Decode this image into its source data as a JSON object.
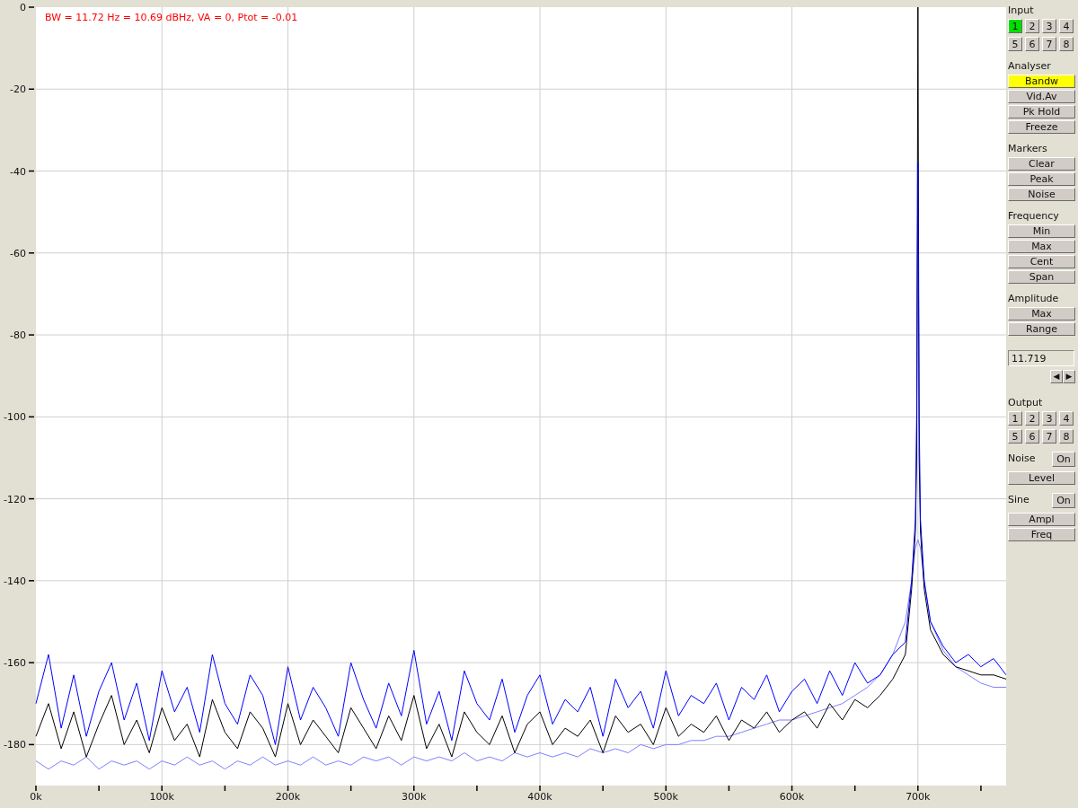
{
  "spectrum": {
    "info": "BW = 11.72 Hz = 10.69 dBHz, VA = 0, Ptot = -0.01",
    "chart_data": {
      "type": "line",
      "grid": true,
      "xlim": [
        0,
        770
      ],
      "ylim": [
        -190,
        0
      ],
      "yticks": [
        0,
        -20,
        -40,
        -60,
        -80,
        -100,
        -120,
        -140,
        -160,
        -180
      ],
      "xticks": [
        {
          "value": 0,
          "label": "0k"
        },
        {
          "value": 100,
          "label": "100k"
        },
        {
          "value": 200,
          "label": "200k"
        },
        {
          "value": 300,
          "label": "300k"
        },
        {
          "value": 400,
          "label": "400k"
        },
        {
          "value": 500,
          "label": "500k"
        },
        {
          "value": 600,
          "label": "600k"
        },
        {
          "value": 700,
          "label": "700k"
        }
      ],
      "x": [
        0,
        10,
        20,
        30,
        40,
        50,
        60,
        70,
        80,
        90,
        100,
        110,
        120,
        130,
        140,
        150,
        160,
        170,
        180,
        190,
        200,
        210,
        220,
        230,
        240,
        250,
        260,
        270,
        280,
        290,
        300,
        310,
        320,
        330,
        340,
        350,
        360,
        370,
        380,
        390,
        400,
        410,
        420,
        430,
        440,
        450,
        460,
        470,
        480,
        490,
        500,
        510,
        520,
        530,
        540,
        550,
        560,
        570,
        580,
        590,
        600,
        610,
        620,
        630,
        640,
        650,
        660,
        670,
        680,
        690,
        695,
        698,
        699,
        700,
        701,
        702,
        705,
        710,
        720,
        730,
        740,
        750,
        760,
        770
      ],
      "series": [
        {
          "color": "#8080ff",
          "values": [
            -184,
            -186,
            -184,
            -185,
            -183,
            -186,
            -184,
            -185,
            -184,
            -186,
            -184,
            -185,
            -183,
            -185,
            -184,
            -186,
            -184,
            -185,
            -183,
            -185,
            -184,
            -185,
            -183,
            -185,
            -184,
            -185,
            -183,
            -184,
            -183,
            -185,
            -183,
            -184,
            -183,
            -184,
            -182,
            -184,
            -183,
            -184,
            -182,
            -183,
            -182,
            -183,
            -182,
            -183,
            -181,
            -182,
            -181,
            -182,
            -180,
            -181,
            -180,
            -180,
            -179,
            -179,
            -178,
            -178,
            -177,
            -176,
            -175,
            -174,
            -174,
            -173,
            -172,
            -171,
            -170,
            -168,
            -166,
            -163,
            -158,
            -150,
            -140,
            -132,
            -131,
            -130,
            -131,
            -132,
            -140,
            -150,
            -157,
            -161,
            -163,
            -165,
            -166,
            -166
          ]
        },
        {
          "color": "#000000",
          "values": [
            -178,
            -170,
            -181,
            -172,
            -183,
            -175,
            -168,
            -180,
            -174,
            -182,
            -171,
            -179,
            -175,
            -183,
            -169,
            -177,
            -181,
            -172,
            -176,
            -183,
            -170,
            -180,
            -174,
            -178,
            -182,
            -171,
            -176,
            -181,
            -173,
            -179,
            -168,
            -181,
            -175,
            -183,
            -172,
            -177,
            -180,
            -173,
            -182,
            -175,
            -172,
            -180,
            -176,
            -178,
            -174,
            -182,
            -173,
            -177,
            -175,
            -180,
            -171,
            -178,
            -175,
            -177,
            -173,
            -179,
            -174,
            -176,
            -172,
            -177,
            -174,
            -172,
            -176,
            -170,
            -174,
            -169,
            -171,
            -168,
            -164,
            -158,
            -142,
            -128,
            -110,
            0,
            -110,
            -128,
            -142,
            -152,
            -158,
            -161,
            -162,
            -163,
            -163,
            -164
          ]
        },
        {
          "color": "#0000ff",
          "values": [
            -170,
            -158,
            -176,
            -163,
            -178,
            -167,
            -160,
            -174,
            -165,
            -179,
            -162,
            -172,
            -166,
            -177,
            -158,
            -170,
            -175,
            -163,
            -168,
            -180,
            -161,
            -174,
            -166,
            -171,
            -178,
            -160,
            -169,
            -176,
            -165,
            -173,
            -157,
            -175,
            -167,
            -179,
            -162,
            -170,
            -174,
            -164,
            -177,
            -168,
            -163,
            -175,
            -169,
            -172,
            -166,
            -178,
            -164,
            -171,
            -167,
            -176,
            -162,
            -173,
            -168,
            -170,
            -165,
            -174,
            -166,
            -169,
            -163,
            -172,
            -167,
            -164,
            -170,
            -162,
            -168,
            -160,
            -165,
            -163,
            -158,
            -155,
            -140,
            -125,
            -100,
            -38,
            -100,
            -125,
            -140,
            -150,
            -156,
            -160,
            -158,
            -161,
            -159,
            -163
          ]
        }
      ]
    }
  },
  "panel": [
    {
      "kind": "grid",
      "title": "Input",
      "buttons": [
        {
          "label": "1",
          "selected": true
        },
        {
          "label": "2",
          "selected": false
        },
        {
          "label": "3",
          "selected": false
        },
        {
          "label": "4",
          "selected": false
        },
        {
          "label": "5",
          "selected": false
        },
        {
          "label": "6",
          "selected": false
        },
        {
          "label": "7",
          "selected": false
        },
        {
          "label": "8",
          "selected": false
        }
      ]
    },
    {
      "kind": "stack",
      "title": "Analyser",
      "buttons": [
        {
          "label": "Bandw",
          "on": true
        },
        {
          "label": "Vid.Av",
          "on": false
        },
        {
          "label": "Pk Hold",
          "on": false
        },
        {
          "label": "Freeze",
          "on": false
        }
      ]
    },
    {
      "kind": "stack",
      "title": "Markers",
      "buttons": [
        {
          "label": "Clear",
          "on": false
        },
        {
          "label": "Peak",
          "on": false
        },
        {
          "label": "Noise",
          "on": false
        }
      ]
    },
    {
      "kind": "stack",
      "title": "Frequency",
      "buttons": [
        {
          "label": "Min",
          "on": false
        },
        {
          "label": "Max",
          "on": false
        },
        {
          "label": "Cent",
          "on": false
        },
        {
          "label": "Span",
          "on": false
        }
      ]
    },
    {
      "kind": "stack",
      "title": "Amplitude",
      "buttons": [
        {
          "label": "Max",
          "on": false
        },
        {
          "label": "Range",
          "on": false
        }
      ]
    },
    {
      "kind": "field",
      "value": "11.719",
      "arrows": [
        "◀",
        "▶"
      ]
    },
    {
      "kind": "grid",
      "title": "Output",
      "buttons": [
        {
          "label": "1",
          "selected": false
        },
        {
          "label": "2",
          "selected": false
        },
        {
          "label": "3",
          "selected": false
        },
        {
          "label": "4",
          "selected": false
        },
        {
          "label": "5",
          "selected": false
        },
        {
          "label": "6",
          "selected": false
        },
        {
          "label": "7",
          "selected": false
        },
        {
          "label": "8",
          "selected": false
        }
      ]
    },
    {
      "kind": "toggle",
      "title": "Noise",
      "toggle": {
        "label": "On",
        "on": false
      },
      "buttons": [
        {
          "label": "Level",
          "on": false
        }
      ]
    },
    {
      "kind": "toggle",
      "title": "Sine",
      "toggle": {
        "label": "On",
        "on": false
      },
      "buttons": [
        {
          "label": "Ampl",
          "on": false
        },
        {
          "label": "Freq",
          "on": false
        }
      ]
    }
  ]
}
